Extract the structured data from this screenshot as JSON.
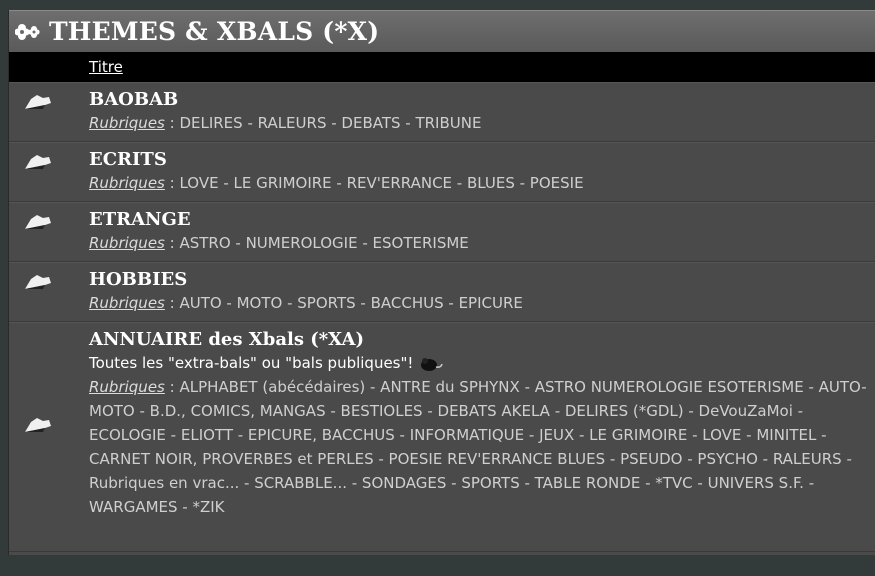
{
  "header": {
    "title": "THEMES & XBALS (*X)",
    "icon": "flower-icon"
  },
  "columns": {
    "title_label": "Titre"
  },
  "rubriques_label": "Rubriques",
  "rows": [
    {
      "title": "BAOBAB",
      "rubriques": " : DELIRES - RALEURS - DEBATS - TRIBUNE",
      "icon": "folder-icon"
    },
    {
      "title": "ECRITS",
      "rubriques": " : LOVE - LE GRIMOIRE - REV'ERRANCE - BLUES - POESIE",
      "icon": "folder-icon"
    },
    {
      "title": "ETRANGE",
      "rubriques": " : ASTRO - NUMEROLOGIE - ESOTERISME",
      "icon": "folder-icon"
    },
    {
      "title": "HOBBIES",
      "rubriques": " : AUTO - MOTO - SPORTS - BACCHUS - EPICURE",
      "icon": "folder-icon"
    }
  ],
  "annuaire": {
    "title": "ANNUAIRE des Xbals (*XA)",
    "description": "Toutes les \"extra-bals\" ou \"bals publiques\"!",
    "rubriques": " : ALPHABET (abécédaires) - ANTRE du SPHYNX - ASTRO NUMEROLOGIE ESOTERISME - AUTO-MOTO - B.D., COMICS,  MANGAS - BESTIOLES - DEBATS AKELA - DELIRES (*GDL) - DeVouZaMoi - ECOLOGIE - ELIOTT - EPICURE, BACCHUS - INFORMATIQUE - JEUX - LE GRIMOIRE - LOVE - MINITEL - CARNET NOIR, PROVERBES et PERLES - POESIE REV'ERRANCE BLUES - PSEUDO - PSYCHO - RALEURS - Rubriques en vrac... - SCRABBLE... - SONDAGES - SPORTS - TABLE RONDE - *TVC - UNIVERS S.F. - WARGAMES - *ZIK",
    "icon": "folder-icon",
    "emoji": "mouse-icon"
  }
}
